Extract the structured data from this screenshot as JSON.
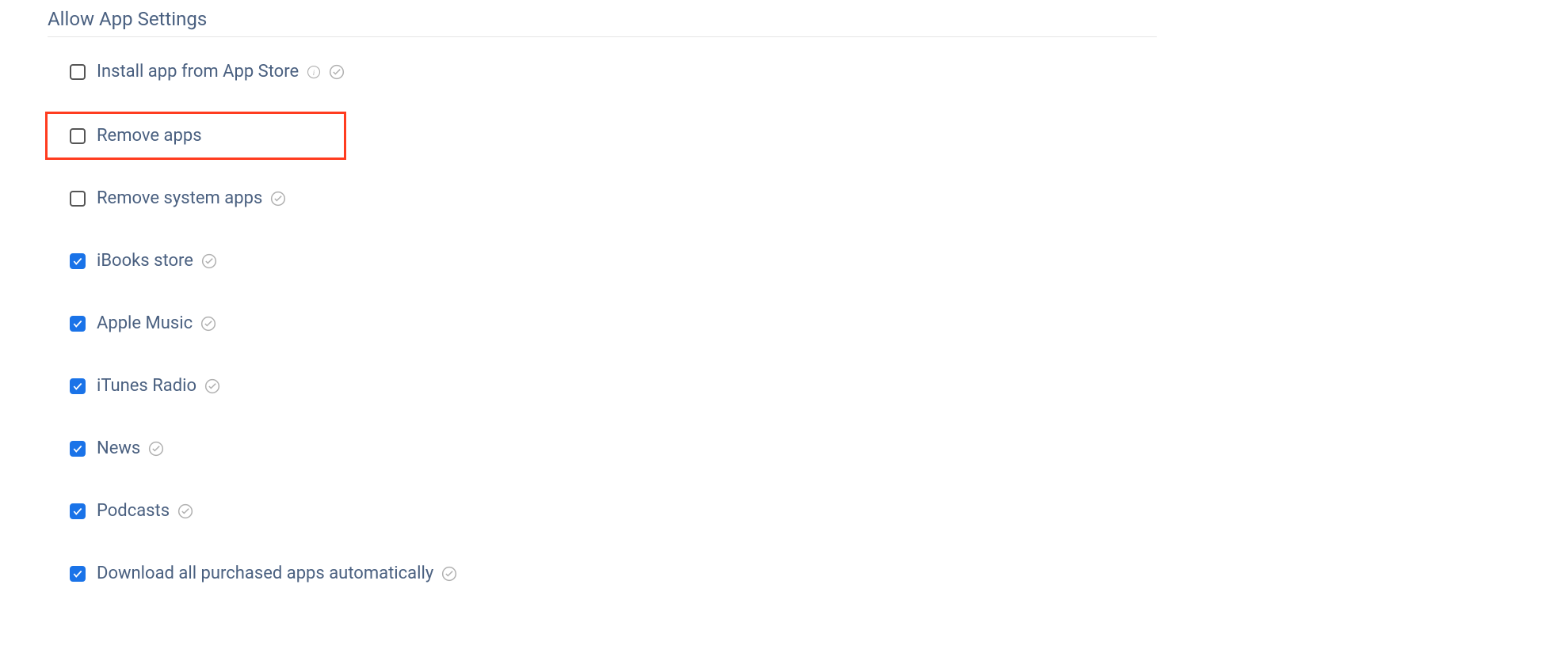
{
  "section": {
    "title": "Allow App Settings",
    "settings": [
      {
        "label": "Install app from App Store",
        "checked": false,
        "hasInfo": true,
        "hasSupervised": true,
        "highlighted": false
      },
      {
        "label": "Remove apps",
        "checked": false,
        "hasInfo": false,
        "hasSupervised": false,
        "highlighted": true
      },
      {
        "label": "Remove system apps",
        "checked": false,
        "hasInfo": false,
        "hasSupervised": true,
        "highlighted": false
      },
      {
        "label": "iBooks store",
        "checked": true,
        "hasInfo": false,
        "hasSupervised": true,
        "highlighted": false
      },
      {
        "label": "Apple Music",
        "checked": true,
        "hasInfo": false,
        "hasSupervised": true,
        "highlighted": false
      },
      {
        "label": "iTunes Radio",
        "checked": true,
        "hasInfo": false,
        "hasSupervised": true,
        "highlighted": false
      },
      {
        "label": "News",
        "checked": true,
        "hasInfo": false,
        "hasSupervised": true,
        "highlighted": false
      },
      {
        "label": "Podcasts",
        "checked": true,
        "hasInfo": false,
        "hasSupervised": true,
        "highlighted": false
      },
      {
        "label": "Download all purchased apps automatically",
        "checked": true,
        "hasInfo": false,
        "hasSupervised": true,
        "highlighted": false
      }
    ]
  }
}
